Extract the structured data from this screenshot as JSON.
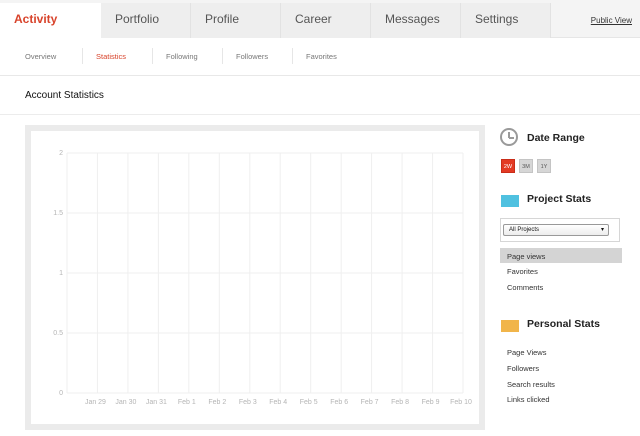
{
  "tabs": [
    {
      "label": "Activity",
      "active": true
    },
    {
      "label": "Portfolio",
      "active": false
    },
    {
      "label": "Profile",
      "active": false
    },
    {
      "label": "Career",
      "active": false
    },
    {
      "label": "Messages",
      "active": false
    },
    {
      "label": "Settings",
      "active": false
    }
  ],
  "public_view": "Public View",
  "subnav": [
    {
      "label": "Overview",
      "active": false
    },
    {
      "label": "Statistics",
      "active": true
    },
    {
      "label": "Following",
      "active": false
    },
    {
      "label": "Followers",
      "active": false
    },
    {
      "label": "Favorites",
      "active": false
    }
  ],
  "section_title": "Account Statistics",
  "sidebar": {
    "date_range": {
      "title": "Date Range",
      "icon": "clock-icon",
      "buttons": [
        {
          "label": "2W",
          "active": true
        },
        {
          "label": "3M",
          "active": false
        },
        {
          "label": "1Y",
          "active": false
        }
      ]
    },
    "project_stats": {
      "title": "Project Stats",
      "color": "#4fc1e0",
      "select_value": "All Projects",
      "items": [
        "Page views",
        "Favorites",
        "Comments"
      ],
      "selected_index": 0
    },
    "personal_stats": {
      "title": "Personal Stats",
      "color": "#f1b54a",
      "items": [
        "Page Views",
        "Followers",
        "Search results",
        "Links clicked"
      ]
    }
  },
  "accent_color": "#d8432b",
  "chart_data": {
    "type": "line",
    "categories": [
      "Jan 29",
      "Jan 30",
      "Jan 31",
      "Feb 1",
      "Feb 2",
      "Feb 3",
      "Feb 4",
      "Feb 5",
      "Feb 6",
      "Feb 7",
      "Feb 8",
      "Feb 9",
      "Feb 10"
    ],
    "y_ticks": [
      "0",
      "0.5",
      "1",
      "1.5",
      "2"
    ],
    "ylim": [
      0,
      2
    ],
    "series": [],
    "grid": true
  }
}
